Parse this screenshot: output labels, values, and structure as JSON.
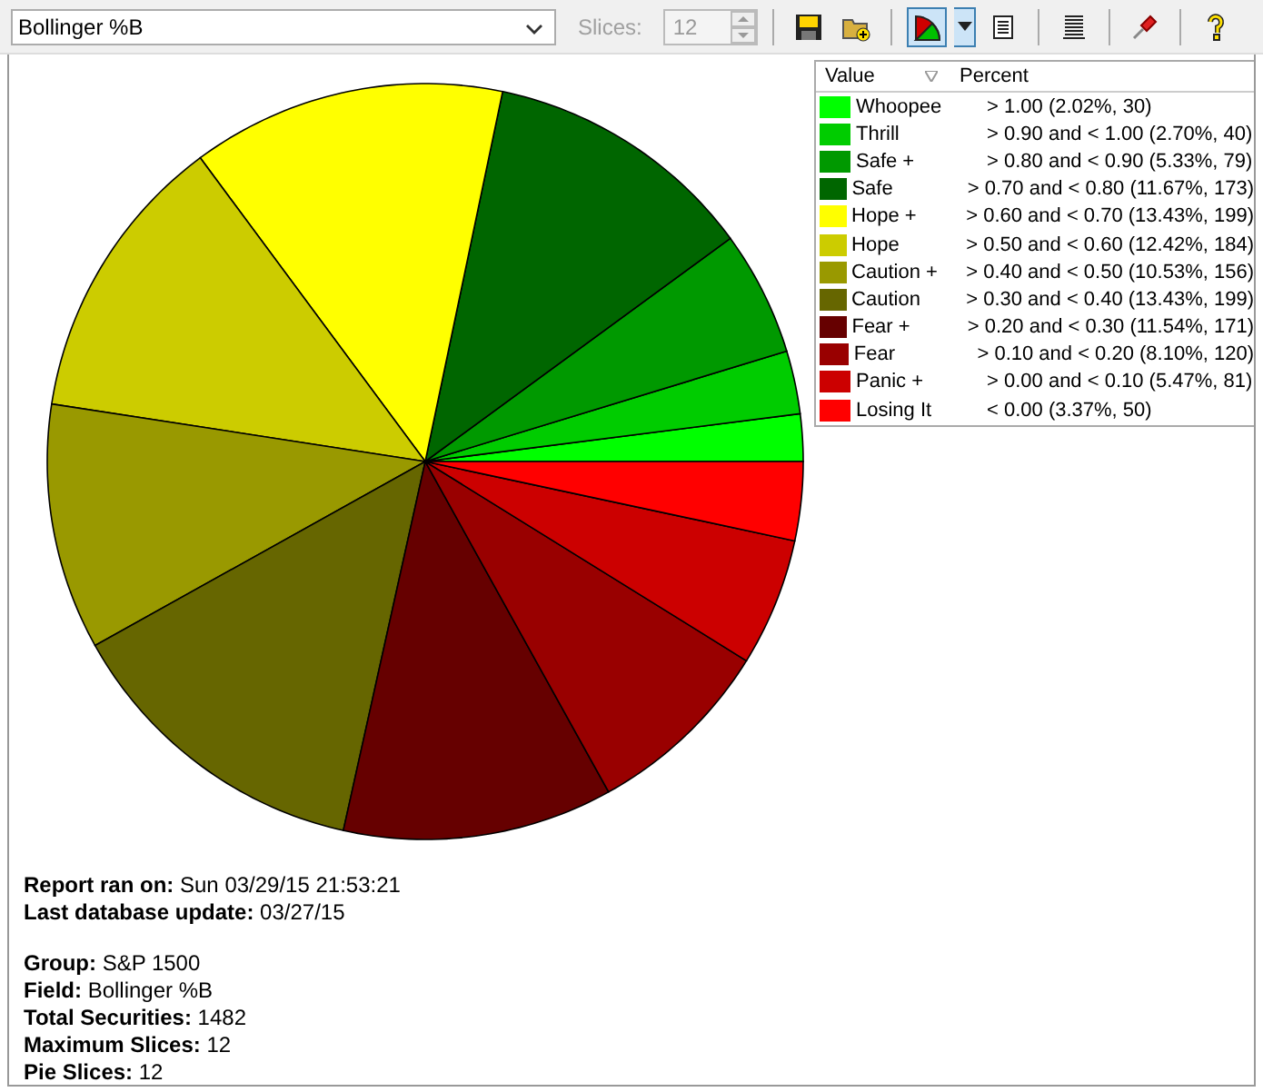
{
  "toolbar": {
    "field_select": {
      "value": "Bollinger %B"
    },
    "slices_label": {
      "text": "Slices:",
      "disabled": true
    },
    "slices_spinner": {
      "value": "12",
      "disabled": true
    },
    "pie_button": {
      "selected": true
    }
  },
  "legend": {
    "columns": [
      "Value"
    ],
    "items": [
      {
        "range": "> 1.00 (2.02%, 30)",
        "color": "#00ff00"
      },
      {
        "range": "> 0.90 and < 1.00 (2.70%, 40)",
        "color": "#00cc00"
      },
      {
        "range": "> 0.80 and < 0.90 (5.33%, 79)",
        "color": "#009900"
      },
      {
        "range": "> 0.70 and < 0.80 (11.67%, 173)",
        "color": "#006600"
      },
      {
        "range": "> 0.60 and < 0.70 (13.43%, 199)",
        "color": "#ffff00"
      },
      {
        "range": "> 0.50 and < 0.60 (12.42%, 184)",
        "color": "#cccc00"
      },
      {
        "range": "> 0.40 and < 0.50 (10.53%, 156)",
        "color": "#999900"
      },
      {
        "range": "> 0.30 and < 0.40 (13.43%, 199)",
        "color": "#666600"
      },
      {
        "range": "> 0.20 and < 0.30 (11.54%, 171)",
        "color": "#660000"
      },
      {
        "range": "> 0.10 and < 0.20 (8.10%, 120)",
        "color": "#990000"
      },
      {
        "range": "> 0.00 and < 0.10 (5.47%, 81)",
        "color": "#cc0000"
      },
      {
        "range": "< 0.00 (3.37%, 50)",
        "color": "#ff0000"
      }
    ]
  },
  "chart_data": {
    "type": "pie",
    "categories": [
      "Whoopee",
      "Thrill",
      "Safe +",
      "Safe",
      "Hope +",
      "Hope",
      "Caution +",
      "Caution",
      "Fear +",
      "Fear",
      "Panic +",
      "Losing It"
    ],
    "series": [
      {
        "name": "Percent",
        "values": [
          2.02,
          2.7,
          5.33,
          11.67,
          13.43,
          12.42,
          10.53,
          13.43,
          11.54,
          8.1,
          5.47,
          3.37
        ]
      }
    ]
  },
  "report": [
    [
      "**Report ran on:** Sun 03/29/15 21:53:21",
      "**Last database update:** 03/27/15"
    ],
    [
      "**Group:** S&P 1500",
      "**Field:** Bollinger %B",
      "**Total Securities:** 1482",
      "**Maximum Slices:** 12",
      "**Pie Slices:** 12"
    ]
  ]
}
